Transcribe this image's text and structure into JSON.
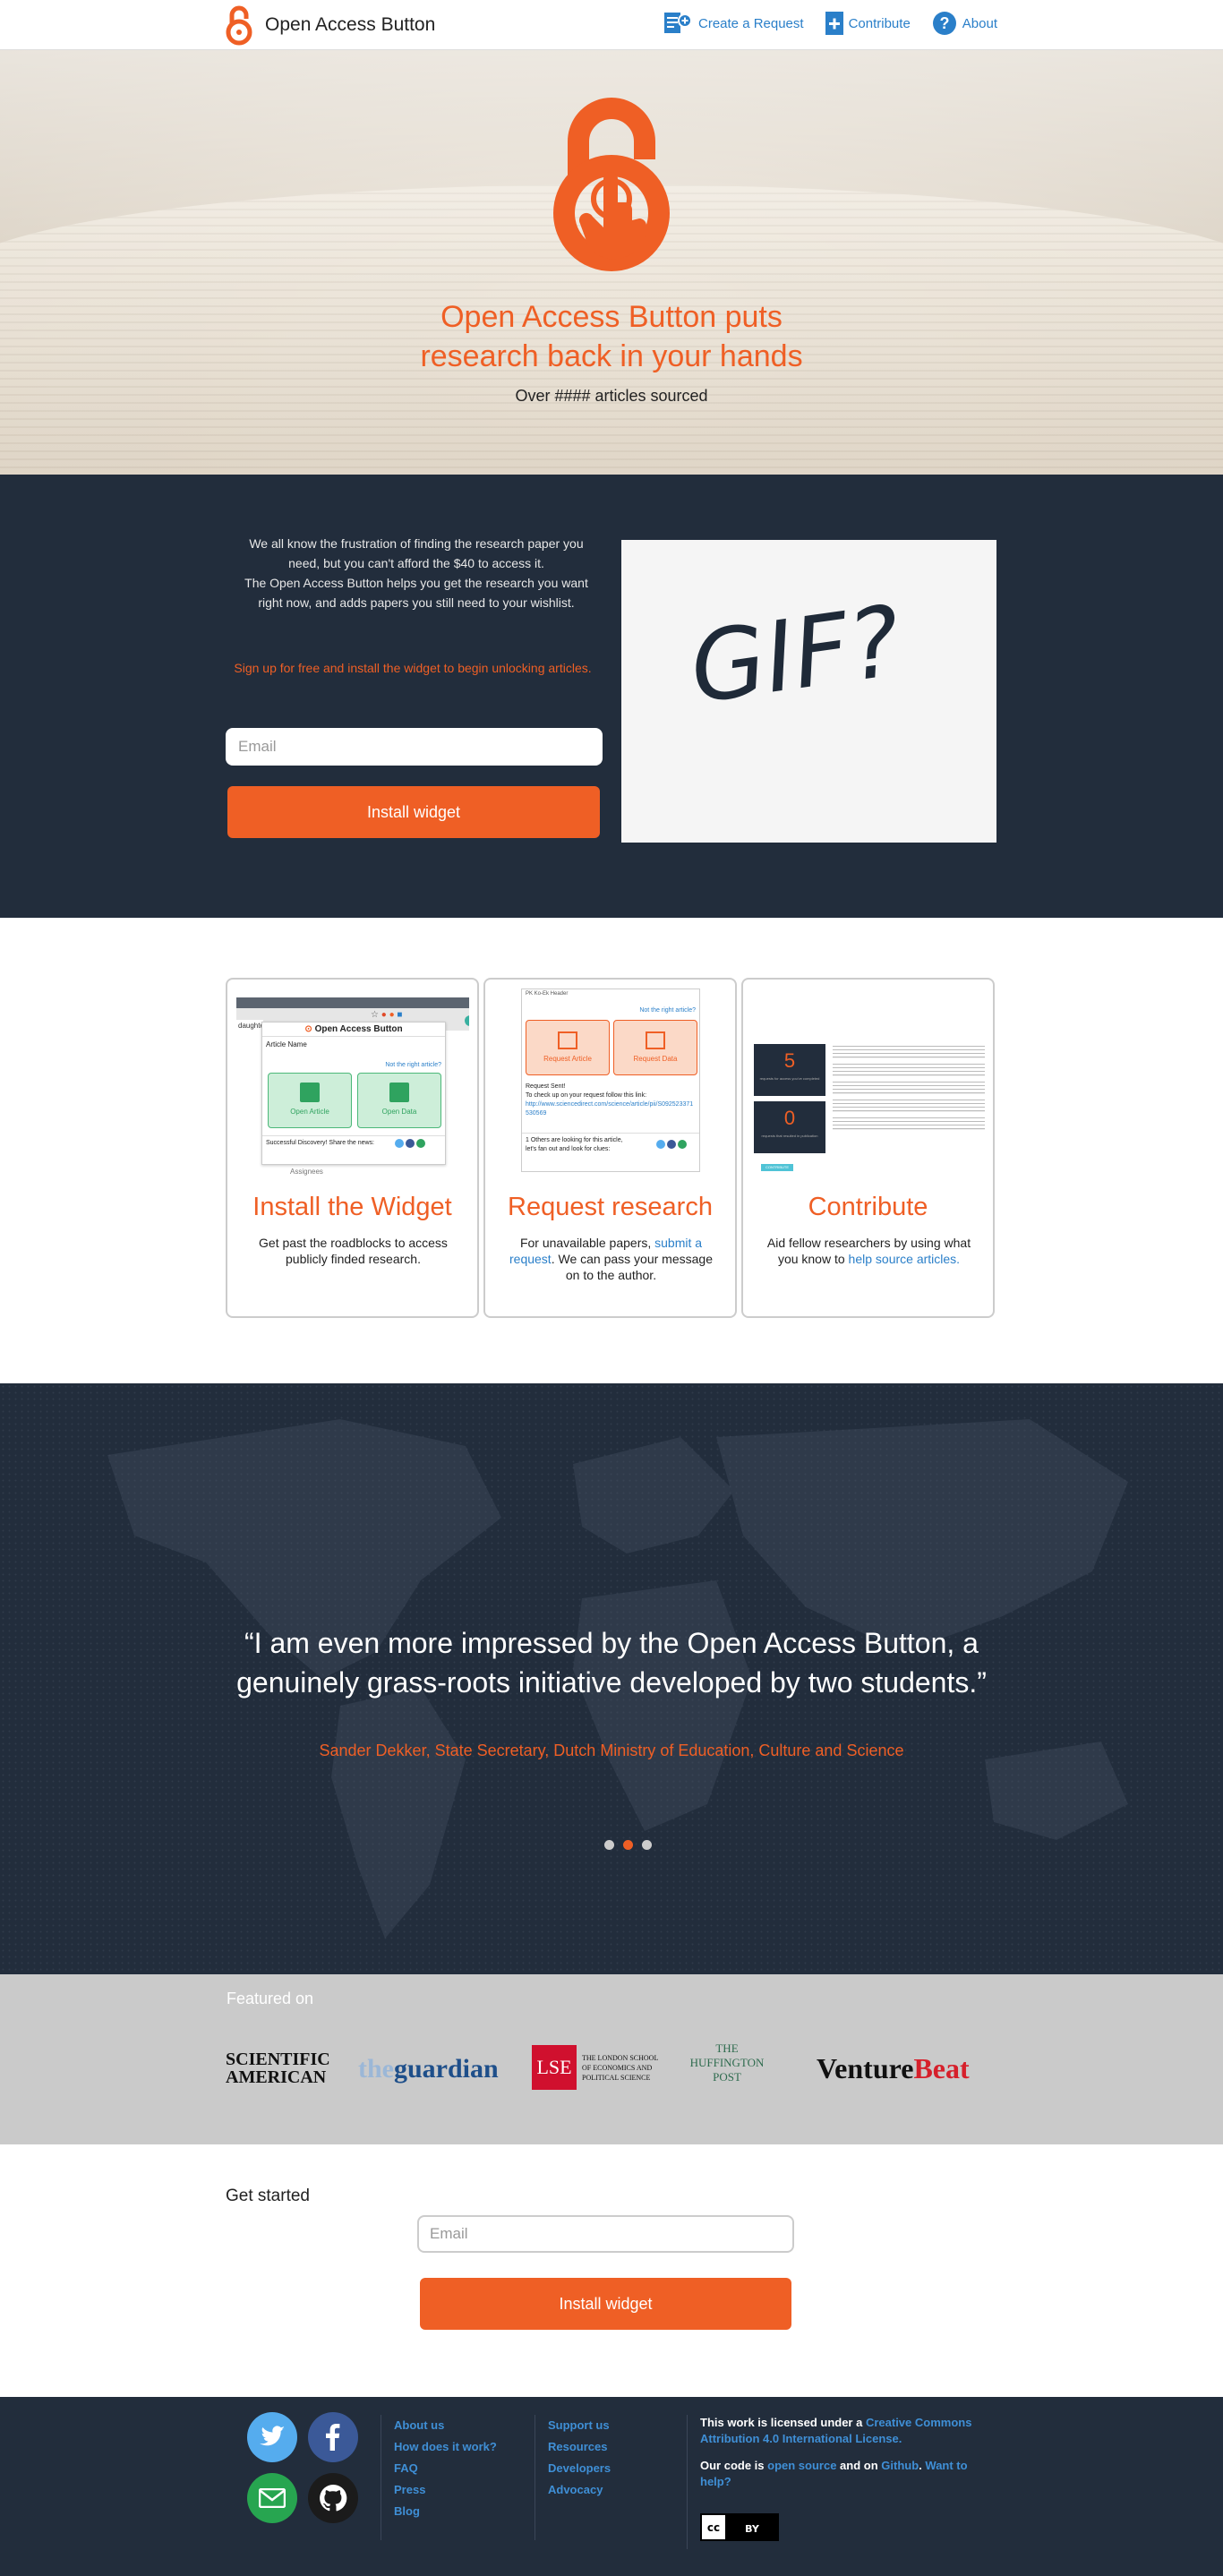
{
  "nav": {
    "brand": "Open Access Button",
    "links": [
      {
        "label": "Create a Request",
        "icon": "create-request-icon"
      },
      {
        "label": "Contribute",
        "icon": "contribute-plus-icon"
      },
      {
        "label": "About",
        "icon": "help-icon"
      }
    ]
  },
  "hero": {
    "title_line1": "Open Access Button puts",
    "title_line2": "research back in your hands",
    "count": "Over #### articles sourced"
  },
  "intro": {
    "p1_line1": "We all know the frustration of finding the research paper you",
    "p1_line2": "need, but you can't afford the $40 to access it.",
    "p2_line1": "The Open Access Button helps you get the research you want",
    "p2_line2": "right now, and adds papers you still need to your wishlist.",
    "signup": "Sign up for free and install the widget to begin unlocking articles.",
    "email_placeholder": "Email",
    "install": "Install widget",
    "gif_text": "GIF?"
  },
  "features": [
    {
      "title": "Install the Widget",
      "desc_line1": "Get past the roadblocks to access",
      "desc_line2": "publicly finded research.",
      "shot": {
        "title": "Open Access Button",
        "article": "Article Name",
        "not_right": "Not the right article?",
        "open_article": "Open Article",
        "open_data": "Open Data",
        "share": "Successful Discovery! Share the news:",
        "tab_partial": "daughter",
        "footer_partial": "Assignees"
      }
    },
    {
      "title": "Request research",
      "desc_a": "For unavailable papers, ",
      "desc_link": "submit a request",
      "desc_b": ". We can pass your message on to the author.",
      "shot": {
        "header": "PK Ko-Ek Header",
        "not_right": "Not the right article?",
        "request_article": "Request Article",
        "request_data": "Request Data",
        "sent": "Request Sent!",
        "check": "To check up on your request follow this link:",
        "url": "http://www.sciencedirect.com/science/article/pii/S092523371530569",
        "others": "1 Others are looking for this article,",
        "others2": "let's fan out and look for clues:"
      }
    },
    {
      "title": "Contribute",
      "desc_a": "Aid fellow researchers by using what you know to ",
      "desc_link": "help source articles.",
      "shot": {
        "stat1": "5",
        "stat1_label": "requests for access you've completed",
        "stat2": "0",
        "stat2_label": "requests that resulted in publication",
        "button": "CONTRIBUTE"
      }
    }
  ],
  "quote": {
    "text_line1": "“I am even more impressed by the Open Access Button, a",
    "text_line2": "genuinely grass-roots initiative developed by two students.”",
    "author": "Sander Dekker, State Secretary, Dutch Ministry of Education, Culture and Science"
  },
  "featured": {
    "label": "Featured on",
    "sciam_line1": "SCIENTIFIC",
    "sciam_line2": "AMERICAN",
    "guardian_the": "the",
    "guardian_name": "guardian",
    "lse_mark": "LSE",
    "lse_line1": "THE LONDON SCHOOL",
    "lse_line2": "OF ECONOMICS AND",
    "lse_line3": "POLITICAL SCIENCE",
    "huff_line1": "THE",
    "huff_line2": "HUFFINGTON",
    "huff_line3": "POST",
    "vb_venture": "Venture",
    "vb_beat": "Beat"
  },
  "getstarted": {
    "label": "Get started",
    "email_placeholder": "Email",
    "install": "Install widget"
  },
  "footer": {
    "col1": [
      "About us",
      "How does it work?",
      "FAQ",
      "Press",
      "Blog"
    ],
    "col2": [
      "Support us",
      "Resources",
      "Developers",
      "Advocacy"
    ],
    "license_a": "This work is licensed under a ",
    "license_link": "Creative Commons Attribution 4.0 International License.",
    "code_a": "Our code is ",
    "code_link1": "open source",
    "code_b": " and on ",
    "code_link2": "Github",
    "code_c": ". ",
    "code_link3": "Want to help?",
    "cc_label": "cc",
    "by_label": "BY"
  },
  "colors": {
    "accent": "#ef5f25",
    "navy": "#222d3c",
    "link": "#2a7fc9"
  }
}
